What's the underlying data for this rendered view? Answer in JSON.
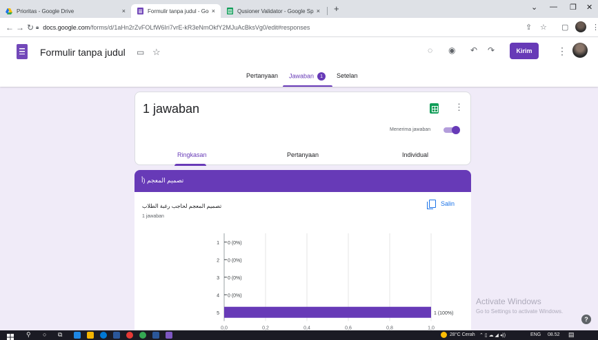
{
  "browser": {
    "tabs": [
      {
        "title": "Prioritas - Google Drive",
        "icon": "google-drive-icon",
        "active": false
      },
      {
        "title": "Formulir tanpa judul - Google Fo",
        "icon": "google-forms-icon",
        "active": true
      },
      {
        "title": "Qusioner Validator - Google Spre",
        "icon": "google-sheets-icon",
        "active": false
      }
    ],
    "close_glyph": "×",
    "new_tab_glyph": "+",
    "url_host": "docs.google.com",
    "url_path": "/forms/d/1aHn2rZvFOLfW6Iri7vrE-kR3eNmOkfY2MJuAcBksVg0/edit#responses"
  },
  "header": {
    "form_title": "Formulir tanpa judul",
    "send_label": "Kirim",
    "tabs": [
      {
        "label": "Pertanyaan"
      },
      {
        "label": "Jawaban",
        "badge": "1"
      },
      {
        "label": "Setelan"
      }
    ]
  },
  "summary": {
    "response_count": "1 jawaban",
    "accepting_label": "Menerima jawaban",
    "accepting": true,
    "sub_tabs": [
      "Ringkasan",
      "Pertanyaan",
      "Individual"
    ]
  },
  "question": {
    "header_text": "تصميم المعجم (أ",
    "title": "تصميم المعجم لحاجب رغبة الطلاب",
    "response_count": "1 jawaban",
    "copy_label": "Salin"
  },
  "chart_data": {
    "type": "bar",
    "orientation": "horizontal",
    "categories": [
      "1",
      "2",
      "3",
      "4",
      "5"
    ],
    "values": [
      0,
      0,
      0,
      0,
      1
    ],
    "data_labels": [
      "0 (0%)",
      "0 (0%)",
      "0 (0%)",
      "0 (0%)",
      "1 (100%)"
    ],
    "x_ticks": [
      "0,0",
      "0,2",
      "0,4",
      "0,6",
      "0,8",
      "1,0"
    ],
    "xlim": [
      0,
      1
    ],
    "grid": true,
    "bar_color": "#673ab7"
  },
  "watermark": {
    "title": "Activate Windows",
    "subtitle": "Go to Settings to activate Windows."
  },
  "taskbar": {
    "weather": "28°C Cerah",
    "language": "ENG",
    "time": "08.52"
  },
  "colors": {
    "accent": "#673ab7",
    "background": "#f0ebf8",
    "link": "#1a73e8",
    "sheets_green": "#0f9d58"
  }
}
